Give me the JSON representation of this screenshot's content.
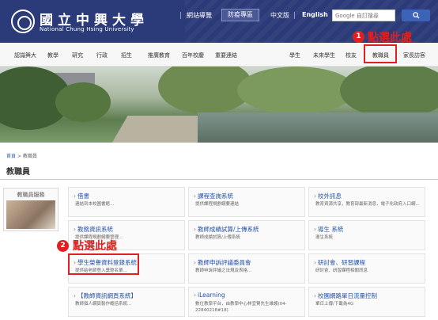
{
  "header": {
    "title_zh": "國立中興大學",
    "title_en": "National Chung Hsing University",
    "links": [
      "網站導覽",
      "防疫專區",
      "中文版",
      "English"
    ],
    "search_placeholder": "Google 自訂搜尋",
    "search_icon": "search-icon"
  },
  "mainnav": {
    "left": [
      "認識興大",
      "教學",
      "研究",
      "行政",
      "招生",
      "推廣教育",
      "百年校慶",
      "重要連結"
    ],
    "right": [
      "學生",
      "未來學生",
      "校友",
      "教職員",
      "家長訪客"
    ]
  },
  "annotations": {
    "one_num": "1",
    "one_text": "點選此處",
    "two_num": "2",
    "two_text": "點選此處"
  },
  "breadcrumb": {
    "home": "首頁",
    "sep": ">",
    "current": "教職員"
  },
  "page_title": "教職員",
  "sidebar": {
    "label": "教職員服務"
  },
  "cards": [
    {
      "title": "借書",
      "desc": "連結到本校圖書館..."
    },
    {
      "title": "課程查詢系統",
      "desc": "提供課程規劃綱要連結"
    },
    {
      "title": "校外訊息",
      "desc": "教育資源共享，教育部最新消息，電子化政府入口網..."
    },
    {
      "title": "教務資訊系統",
      "desc": "提供課程規劃綱要管理..."
    },
    {
      "title": "教師成績試算/上傳系統",
      "desc": "教師成績試算/上傳系統"
    },
    {
      "title": "導生 系統",
      "desc": "導生系統"
    },
    {
      "title": "學生榮譽資料登錄系統",
      "desc": "提供給老師登入獎懲名單..."
    },
    {
      "title": "教師申訴評議委員會",
      "desc": "教師申訴評議之法規及表格..."
    },
    {
      "title": "研討會、研習課程",
      "desc": "研討會、研習課程相關訊息"
    },
    {
      "title": "【教師資訊網頁系統】",
      "desc": "教師個人網頁製作概括系統..."
    },
    {
      "title": "iLearning",
      "desc": "數位教學平台，由教學中心林宜賢先生維護(04-22840218#18)"
    },
    {
      "title": "校園網路單日流量控制",
      "desc": "單日上傳/下載為4G"
    }
  ],
  "colors": {
    "header_bg": "#2b3a78",
    "link": "#2553a6",
    "annotation": "#e02020"
  }
}
